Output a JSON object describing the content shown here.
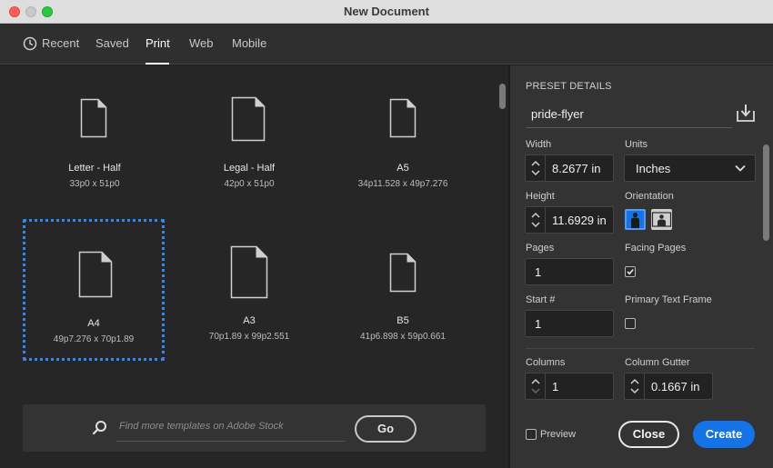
{
  "window": {
    "title": "New Document"
  },
  "tabs": [
    {
      "label": "Recent"
    },
    {
      "label": "Saved"
    },
    {
      "label": "Print"
    },
    {
      "label": "Web"
    },
    {
      "label": "Mobile"
    }
  ],
  "active_tab": "Print",
  "presets": [
    {
      "name": "Letter - Half",
      "size": "33p0 x 51p0",
      "selected": false
    },
    {
      "name": "Legal - Half",
      "size": "42p0 x 51p0",
      "selected": false
    },
    {
      "name": "A5",
      "size": "34p11.528 x 49p7.276",
      "selected": false
    },
    {
      "name": "A4",
      "size": "49p7.276 x 70p1.89",
      "selected": true
    },
    {
      "name": "A3",
      "size": "70p1.89 x 99p2.551",
      "selected": false
    },
    {
      "name": "B5",
      "size": "41p6.898 x 59p0.661",
      "selected": false
    }
  ],
  "search": {
    "placeholder": "Find more templates on Adobe Stock",
    "go_label": "Go"
  },
  "preset_details": {
    "heading": "PRESET DETAILS",
    "name": "pride-flyer",
    "width_label": "Width",
    "width_value": "8.2677 in",
    "units_label": "Units",
    "units_value": "Inches",
    "height_label": "Height",
    "height_value": "11.6929 in",
    "orientation_label": "Orientation",
    "orientation_selected": "portrait",
    "pages_label": "Pages",
    "pages_value": "1",
    "facing_pages_label": "Facing Pages",
    "facing_pages_checked": true,
    "start_label": "Start #",
    "start_value": "1",
    "primary_text_frame_label": "Primary Text Frame",
    "primary_text_frame_checked": false,
    "columns_label": "Columns",
    "columns_value": "1",
    "gutter_label": "Column Gutter",
    "gutter_value": "0.1667 in"
  },
  "footer": {
    "preview_label": "Preview",
    "preview_checked": false,
    "close_label": "Close",
    "create_label": "Create"
  },
  "colors": {
    "accent": "#1473e6",
    "selection": "#2d8ceb",
    "panel_bg": "#262626",
    "details_bg": "#333333"
  }
}
